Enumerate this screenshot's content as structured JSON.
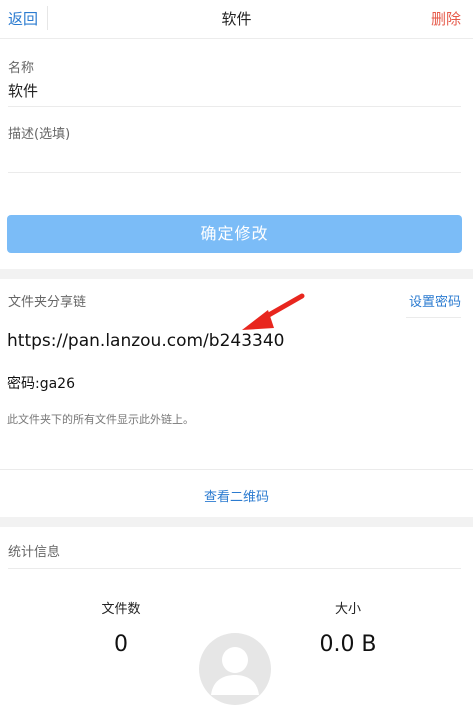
{
  "header": {
    "back_label": "返回",
    "title": "软件",
    "delete_label": "删除"
  },
  "form": {
    "name_label": "名称",
    "name_value": "软件",
    "desc_label": "描述(选填)",
    "confirm_label": "确定修改"
  },
  "share": {
    "section_title": "文件夹分享链",
    "set_password_label": "设置密码",
    "url": "https://pan.lanzou.com/b243340",
    "password_text": "密码:ga26",
    "note": "此文件夹下的所有文件显示此外链上。",
    "qr_label": "查看二维码"
  },
  "stats": {
    "section_title": "统计信息",
    "file_count_label": "文件数",
    "file_count_value": "0",
    "size_label": "大小",
    "size_value": "0.0 B"
  },
  "colors": {
    "accent": "#2b7bd0",
    "danger": "#e65a4a",
    "button": "#7bbcf7",
    "arrow": "#e8261e"
  }
}
